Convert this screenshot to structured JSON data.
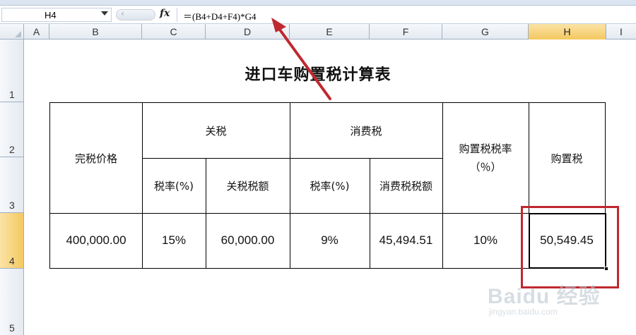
{
  "formula_bar": {
    "name_box": "H4",
    "fx_label": "fx",
    "formula": "＝(B4+D4+F4)*G4"
  },
  "columns": [
    "A",
    "B",
    "C",
    "D",
    "E",
    "F",
    "G",
    "H",
    "I"
  ],
  "active_column": "H",
  "rows": [
    "1",
    "2",
    "3",
    "4",
    "5"
  ],
  "active_row": "4",
  "sheet": {
    "title": "进口车购置税计算表",
    "headers": {
      "dutiable_price": "完税价格",
      "tariff": "关税",
      "tariff_rate": "税率(%)",
      "tariff_amount": "关税税额",
      "consumption_tax": "消费税",
      "consumption_rate": "税率(%)",
      "consumption_amount": "消费税税额",
      "purchase_tax_rate_line1": "购置税税率",
      "purchase_tax_rate_line2": "（％）",
      "purchase_tax": "购置税"
    },
    "values": {
      "dutiable_price": "400,000.00",
      "tariff_rate": "15%",
      "tariff_amount": "60,000.00",
      "consumption_rate": "9%",
      "consumption_amount": "45,494.51",
      "purchase_tax_rate": "10%",
      "purchase_tax": "50,549.45"
    }
  },
  "annotation": {
    "highlight_color": "#c0282f",
    "active_header_color": "#f4c860"
  },
  "watermark": {
    "logo": "Baidu 经验",
    "url": "jingyan.baidu.com"
  }
}
